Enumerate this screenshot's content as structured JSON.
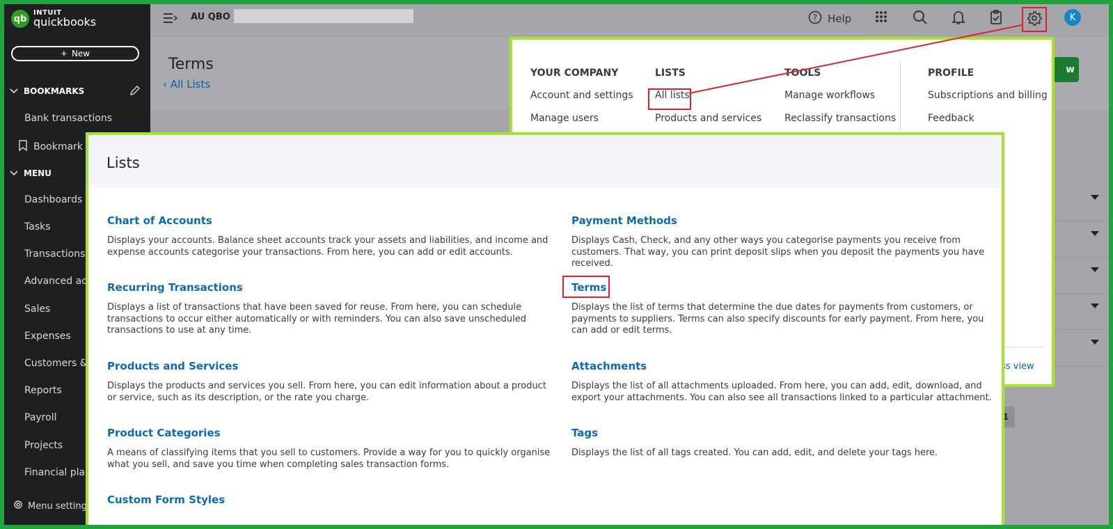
{
  "app": {
    "logo_small": "INTUIT",
    "logo_main": "quickbooks",
    "new_label": "New"
  },
  "sidebar": {
    "bookmarks_header": "BOOKMARKS",
    "bookmark_items": [
      "Bank transactions",
      "Bookmark t"
    ],
    "menu_header": "MENU",
    "menu_items": [
      "Dashboards",
      "Tasks",
      "Transactions",
      "Advanced acc",
      "Sales",
      "Expenses",
      "Customers & l",
      "Reports",
      "Payroll",
      "Projects",
      "Financial plan"
    ],
    "footer": "Menu setting"
  },
  "topbar": {
    "company": "AU QBO A",
    "help": "Help",
    "avatar": "K"
  },
  "page": {
    "title": "Terms",
    "back": "All Lists",
    "green_button": "w"
  },
  "settings_menu": {
    "your_company": {
      "header": "YOUR COMPANY",
      "items": [
        "Account and settings",
        "Manage users"
      ]
    },
    "lists": {
      "header": "LISTS",
      "items": [
        "All lists",
        "Products and services"
      ]
    },
    "tools": {
      "header": "TOOLS",
      "items": [
        "Manage workflows",
        "Reclassify transactions"
      ]
    },
    "profile": {
      "header": "PROFILE",
      "items": [
        "Subscriptions and billing",
        "Feedback"
      ]
    },
    "less_view": "ess view"
  },
  "lists_panel": {
    "title": "Lists",
    "items": [
      {
        "title": "Chart of Accounts",
        "desc": "Displays your accounts. Balance sheet accounts track your assets and liabilities, and income and expense accounts categorise your transactions. From here, you can add or edit accounts."
      },
      {
        "title": "Payment Methods",
        "desc": "Displays Cash, Check, and any other ways you categorise payments you receive from customers. That way, you can print deposit slips when you deposit the payments you have received."
      },
      {
        "title": "Recurring Transactions",
        "desc": "Displays a list of transactions that have been saved for reuse. From here, you can schedule transactions to occur either automatically or with reminders. You can also save unscheduled transactions to use at any time."
      },
      {
        "title": "Terms",
        "desc": "Displays the list of terms that determine the due dates for payments from customers, or payments to suppliers. Terms can also specify discounts for early payment. From here, you can add or edit terms."
      },
      {
        "title": "Products and Services",
        "desc": "Displays the products and services you sell. From here, you can edit information about a product or service, such as its description, or the rate you charge."
      },
      {
        "title": "Attachments",
        "desc": "Displays the list of all attachments uploaded. From here, you can add, edit, download, and export your attachments. You can also see all transactions linked to a particular attachment."
      },
      {
        "title": "Product Categories",
        "desc": "A means of classifying items that you sell to customers. Provide a way for you to quickly organise what you sell, and save you time when completing sales transaction forms."
      },
      {
        "title": "Tags",
        "desc": "Displays the list of all tags created. You can add, edit, and delete your tags here."
      },
      {
        "title": "Custom Form Styles",
        "desc": ""
      }
    ]
  },
  "background": {
    "page_number": "1"
  },
  "colors": {
    "highlight_border": "#a6e22e",
    "annotation_red": "#e0202a",
    "link_blue": "#0b6bb5",
    "brand_green": "#2ca01c"
  }
}
